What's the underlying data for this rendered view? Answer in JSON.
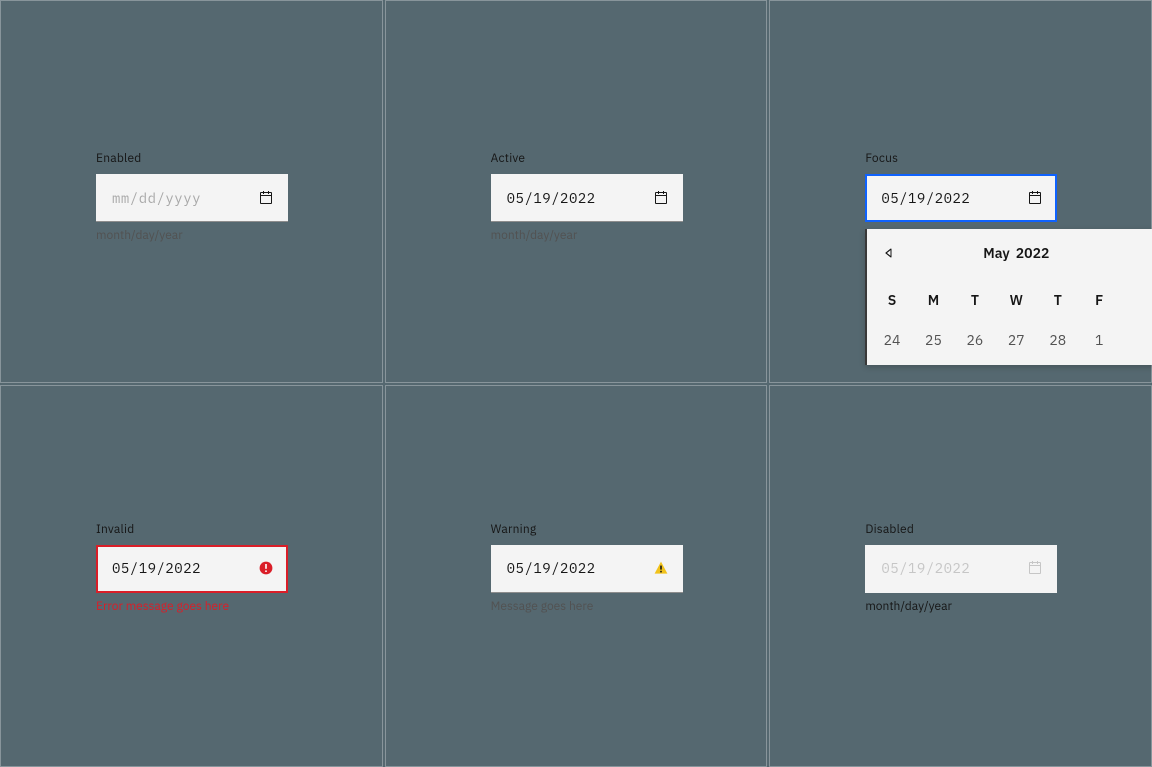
{
  "states": {
    "enabled": {
      "label": "Enabled",
      "placeholder": "mm/dd/yyyy",
      "help": "month/day/year"
    },
    "active": {
      "label": "Active",
      "value": "05/19/2022",
      "help": "month/day/year"
    },
    "focus": {
      "label": "Focus",
      "value": "05/19/2022"
    },
    "invalid": {
      "label": "Invalid",
      "value": "05/19/2022",
      "error": "Error message goes here"
    },
    "warning": {
      "label": "Warning",
      "value": "05/19/2022",
      "message": "Message goes here"
    },
    "disabled": {
      "label": "Disabled",
      "value": "05/19/2022",
      "help": "month/day/year"
    }
  },
  "calendar": {
    "month": "May",
    "year": "2022",
    "weekdays": [
      "S",
      "M",
      "T",
      "W",
      "T",
      "F"
    ],
    "prev_days": [
      "24",
      "25",
      "26",
      "27",
      "28",
      "1"
    ]
  }
}
